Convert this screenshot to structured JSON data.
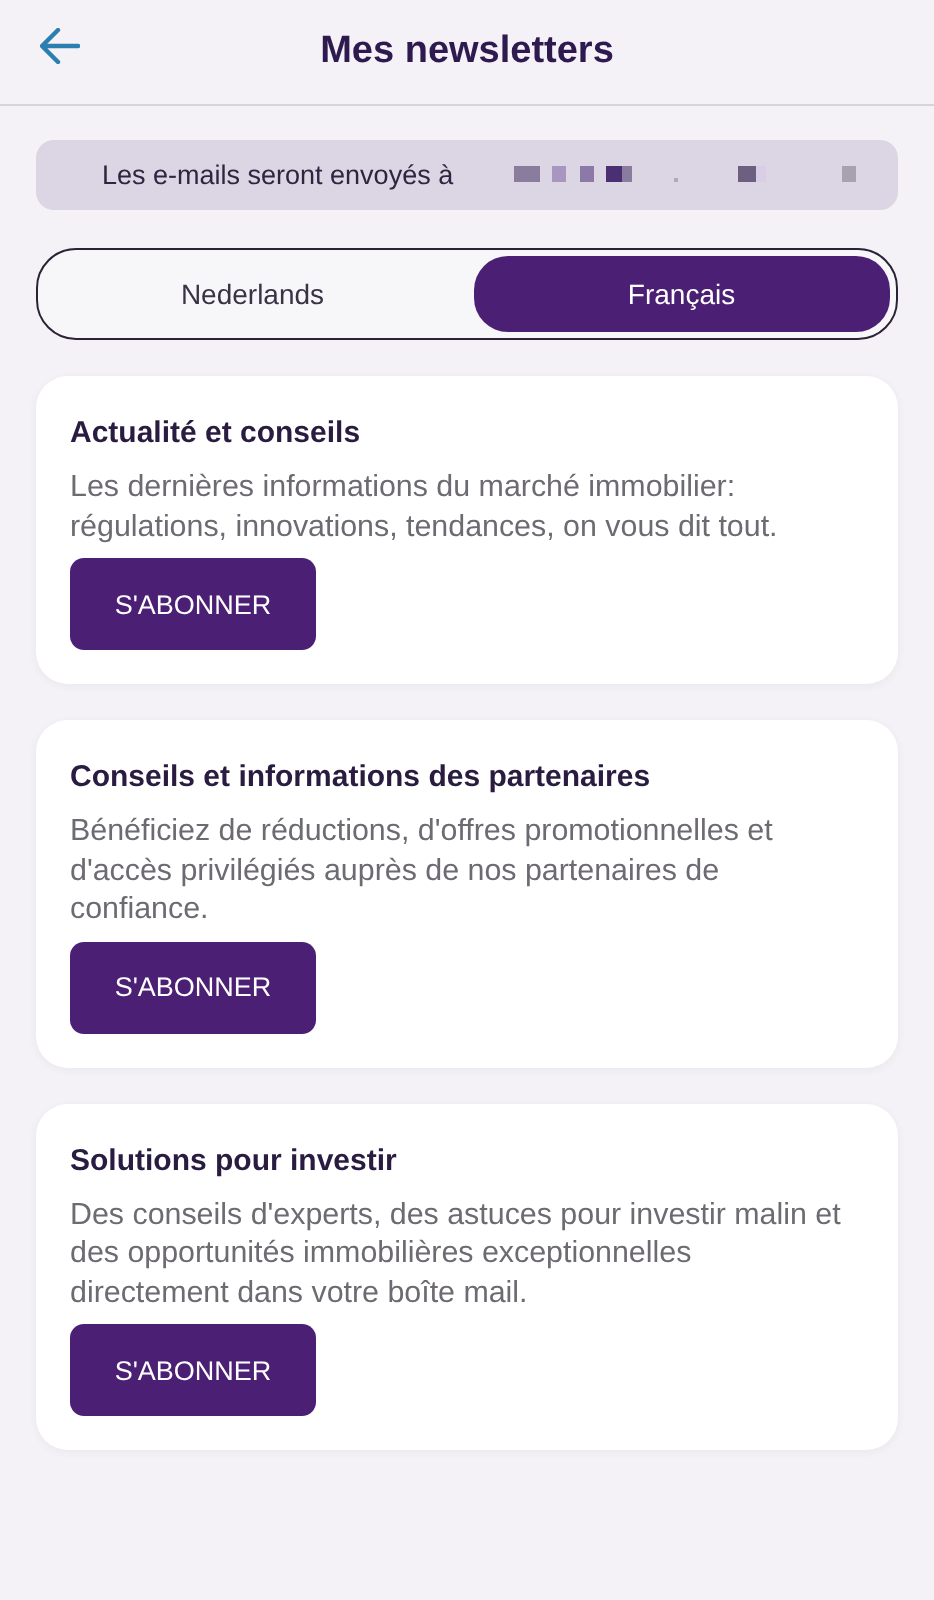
{
  "header": {
    "title": "Mes newsletters"
  },
  "email_notice": {
    "label": "Les e-mails seront envoyés à"
  },
  "language_toggle": [
    {
      "label": "Nederlands",
      "selected": false
    },
    {
      "label": "Français",
      "selected": true
    }
  ],
  "newsletters": [
    {
      "title": "Actualité et conseils",
      "description": "Les dernières informations du marché immobilier: régulations, innovations, tendances, on vous dit tout.",
      "button": "S'ABONNER"
    },
    {
      "title": "Conseils et informations des partenaires",
      "description": "Bénéficiez de réductions, d'offres promotionnelles et d'accès privilégiés auprès de nos partenaires de confiance.",
      "button": "S'ABONNER"
    },
    {
      "title": "Solutions pour investir",
      "description": "Des conseils d'experts, des astuces pour investir malin et des opportunités immobilières exceptionnelles directement dans votre boîte mail.",
      "button": "S'ABONNER"
    }
  ]
}
